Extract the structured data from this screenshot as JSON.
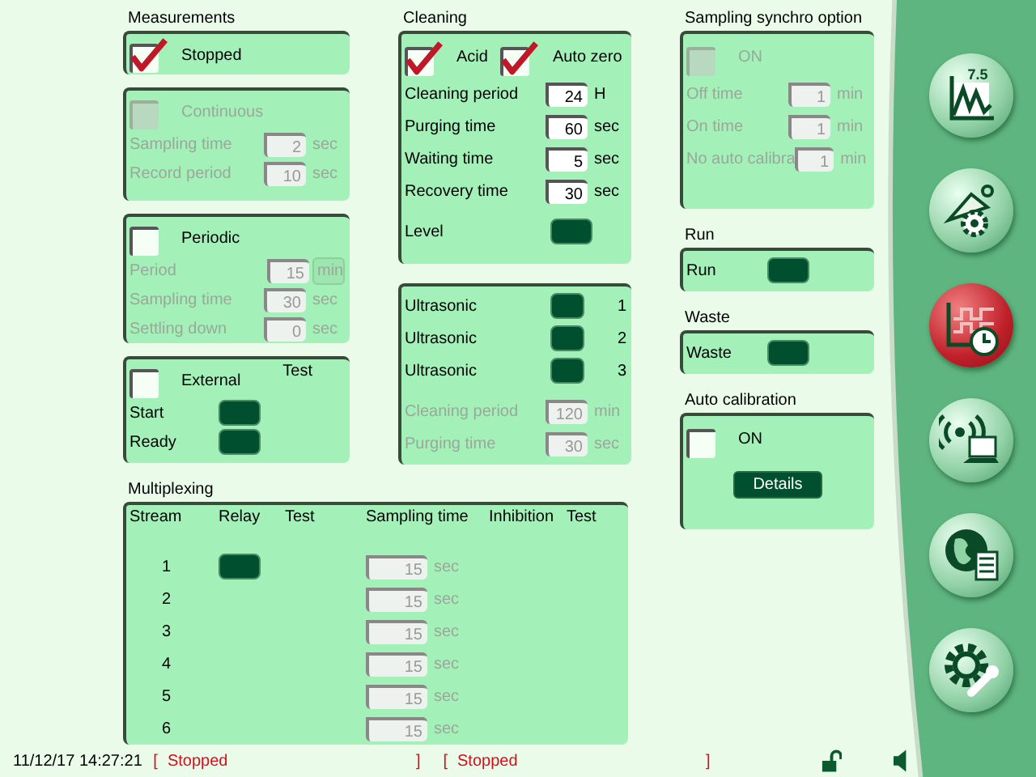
{
  "columns": [
    {
      "panels": [
        {
          "title": "Measurements",
          "rows": [
            {
              "kind": "check",
              "label": "Stopped",
              "checked": true,
              "disabled": false
            }
          ]
        },
        {
          "rows": [
            {
              "kind": "check",
              "label": "Continuous",
              "checked": false,
              "disabled": true
            },
            {
              "kind": "field",
              "label": "Sampling time",
              "value": "2",
              "unit": "sec",
              "unit_button": false,
              "disabled": true
            },
            {
              "kind": "field",
              "label": "Record period",
              "value": "10",
              "unit": "sec",
              "unit_button": false,
              "disabled": true
            }
          ]
        },
        {
          "rows": [
            {
              "kind": "check",
              "label": "Periodic",
              "checked": false,
              "disabled": false
            },
            {
              "kind": "field",
              "label": "Period",
              "value": "15",
              "unit": "min",
              "unit_button": true,
              "disabled": true
            },
            {
              "kind": "field",
              "label": "Sampling time",
              "value": "30",
              "unit": "sec",
              "unit_button": false,
              "disabled": true
            },
            {
              "kind": "field",
              "label": "Settling down",
              "value": "0",
              "unit": "sec",
              "unit_button": false,
              "disabled": true
            }
          ]
        },
        {
          "rows": [
            {
              "kind": "check",
              "label": "External",
              "checked": false,
              "disabled": false,
              "note": "Test"
            },
            {
              "kind": "led",
              "label": "Start"
            },
            {
              "kind": "led",
              "label": "Ready"
            }
          ]
        }
      ]
    },
    {
      "panels": [
        {
          "title": "Cleaning",
          "rows": [
            {
              "kind": "check_pair",
              "items": [
                {
                  "label": "Acid",
                  "checked": true,
                  "disabled": false
                },
                {
                  "label": "Auto zero",
                  "checked": true,
                  "disabled": false
                }
              ]
            },
            {
              "kind": "field",
              "label": "Cleaning period",
              "value": "24",
              "unit": "H",
              "unit_button": false,
              "disabled": false
            },
            {
              "kind": "field",
              "label": "Purging time",
              "value": "60",
              "unit": "sec",
              "unit_button": false,
              "disabled": false
            },
            {
              "kind": "field",
              "label": "Waiting time",
              "value": "5",
              "unit": "sec",
              "unit_button": false,
              "disabled": false
            },
            {
              "kind": "field",
              "label": "Recovery time",
              "value": "30",
              "unit": "sec",
              "unit_button": false,
              "disabled": false
            },
            {
              "kind": "led",
              "label": "Level"
            }
          ]
        },
        {
          "rows": [
            {
              "kind": "led",
              "label": "Ultrasonic",
              "suffix": "1"
            },
            {
              "kind": "led",
              "label": "Ultrasonic",
              "suffix": "2"
            },
            {
              "kind": "led",
              "label": "Ultrasonic",
              "suffix": "3"
            },
            {
              "kind": "field",
              "label": "Cleaning period",
              "value": "120",
              "unit": "min",
              "unit_button": false,
              "disabled": true
            },
            {
              "kind": "field",
              "label": "Purging time",
              "value": "30",
              "unit": "sec",
              "unit_button": false,
              "disabled": true
            }
          ]
        }
      ]
    },
    {
      "panels": [
        {
          "title": "Sampling synchro option",
          "rows": [
            {
              "kind": "check",
              "label": "ON",
              "checked": false,
              "disabled": true
            },
            {
              "kind": "field",
              "label": "Off time",
              "value": "1",
              "unit": "min",
              "unit_button": false,
              "disabled": true
            },
            {
              "kind": "field",
              "label": "On time",
              "value": "1",
              "unit": "min",
              "unit_button": false,
              "disabled": true
            },
            {
              "kind": "field",
              "label": "No auto calibra",
              "value": "1",
              "unit": "min",
              "unit_button": false,
              "disabled": true
            }
          ]
        },
        {
          "title": "Run",
          "rows": [
            {
              "kind": "led",
              "label": "Run"
            }
          ]
        },
        {
          "title": "Waste",
          "rows": [
            {
              "kind": "led",
              "label": "Waste"
            }
          ]
        },
        {
          "title": "Auto calibration",
          "rows": [
            {
              "kind": "check",
              "label": "ON",
              "checked": false,
              "disabled": false
            },
            {
              "kind": "button",
              "label": "Details"
            }
          ]
        }
      ]
    }
  ],
  "multiplexing": {
    "title": "Multiplexing",
    "columns": [
      "Stream",
      "Relay",
      "Test",
      "Sampling time",
      "Inhibition",
      "Test"
    ],
    "rows": [
      {
        "stream": "1",
        "relay": true,
        "value": "15",
        "unit": "sec",
        "disabled": true
      },
      {
        "stream": "2",
        "relay": false,
        "value": "15",
        "unit": "sec",
        "disabled": true
      },
      {
        "stream": "3",
        "relay": false,
        "value": "15",
        "unit": "sec",
        "disabled": true
      },
      {
        "stream": "4",
        "relay": false,
        "value": "15",
        "unit": "sec",
        "disabled": true
      },
      {
        "stream": "5",
        "relay": false,
        "value": "15",
        "unit": "sec",
        "disabled": true
      },
      {
        "stream": "6",
        "relay": false,
        "value": "15",
        "unit": "sec",
        "disabled": true
      }
    ]
  },
  "status_bar": {
    "datetime": "11/12/17  14:27:21",
    "statuses": [
      {
        "open": "[",
        "text": "Stopped",
        "close": "]"
      },
      {
        "open": "[",
        "text": "Stopped",
        "close": "]"
      }
    ],
    "locked": false
  },
  "sidebar": {
    "buttons": [
      {
        "kind": "chart",
        "badge": "7.5",
        "selected": false
      },
      {
        "kind": "alarm",
        "selected": false
      },
      {
        "kind": "schedule",
        "selected": true
      },
      {
        "kind": "network",
        "selected": false
      },
      {
        "kind": "globe",
        "selected": false
      },
      {
        "kind": "tools",
        "selected": false
      }
    ]
  }
}
